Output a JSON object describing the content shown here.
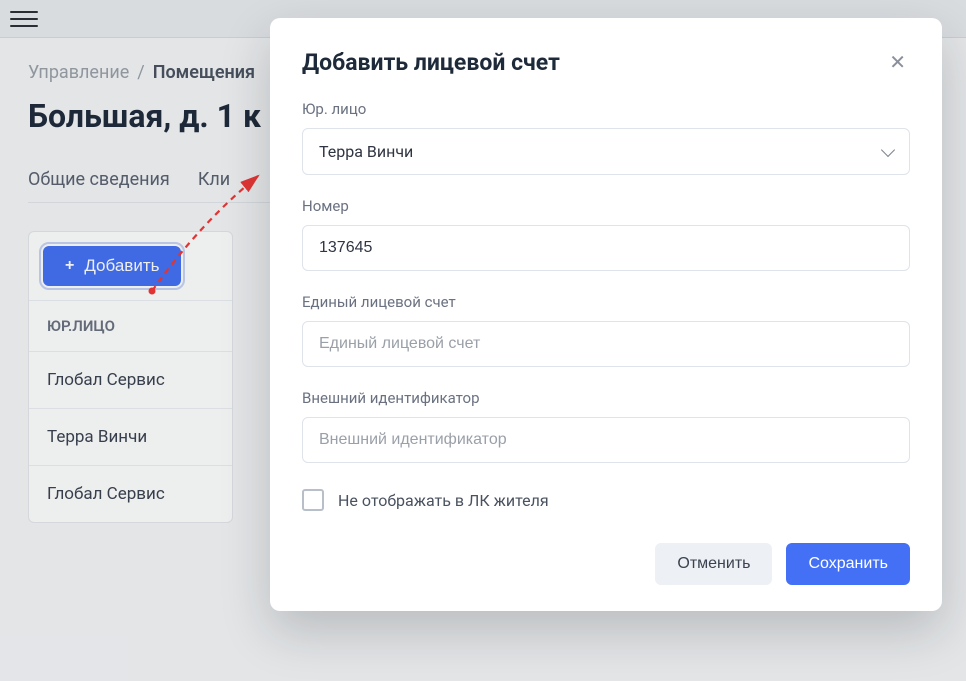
{
  "breadcrumb": {
    "root": "Управление",
    "current": "Помещения"
  },
  "page_title": "Большая, д. 1 к",
  "tabs": {
    "general": "Общие сведения",
    "clients": "Кли"
  },
  "sidebar": {
    "add_label": "Добавить",
    "column_header": "ЮР.ЛИЦО",
    "rows": [
      "Глобал Сервис",
      "Терра Винчи",
      "Глобал Сервис"
    ]
  },
  "modal": {
    "title": "Добавить лицевой счет",
    "fields": {
      "entity": {
        "label": "Юр. лицо",
        "value": "Терра Винчи"
      },
      "number": {
        "label": "Номер",
        "value": "137645"
      },
      "uls": {
        "label": "Единый лицевой счет",
        "placeholder": "Единый лицевой счет",
        "value": ""
      },
      "external_id": {
        "label": "Внешний идентификатор",
        "placeholder": "Внешний идентификатор",
        "value": ""
      },
      "hide_lk": {
        "label": "Не отображать в ЛК жителя",
        "checked": false
      }
    },
    "buttons": {
      "cancel": "Отменить",
      "save": "Сохранить"
    }
  }
}
